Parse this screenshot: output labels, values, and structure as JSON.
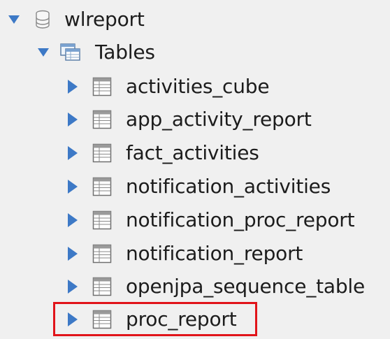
{
  "tree": {
    "database": {
      "label": "wlreport",
      "expanded": true,
      "icon": "database-icon"
    },
    "tables_folder": {
      "label": "Tables",
      "expanded": true,
      "icon": "tables-folder-icon"
    },
    "tables": [
      {
        "label": "activities_cube",
        "expanded": false,
        "icon": "table-icon"
      },
      {
        "label": "app_activity_report",
        "expanded": false,
        "icon": "table-icon"
      },
      {
        "label": "fact_activities",
        "expanded": false,
        "icon": "table-icon"
      },
      {
        "label": "notification_activities",
        "expanded": false,
        "icon": "table-icon"
      },
      {
        "label": "notification_proc_report",
        "expanded": false,
        "icon": "table-icon"
      },
      {
        "label": "notification_report",
        "expanded": false,
        "icon": "table-icon"
      },
      {
        "label": "openjpa_sequence_table",
        "expanded": false,
        "icon": "table-icon"
      },
      {
        "label": "proc_report",
        "expanded": false,
        "icon": "table-icon",
        "highlighted": true
      }
    ]
  },
  "colors": {
    "background": "#f0f0f0",
    "expander_arrow": "#3d79c6",
    "highlight_border": "#e1141a",
    "text": "#1c1c1c"
  }
}
